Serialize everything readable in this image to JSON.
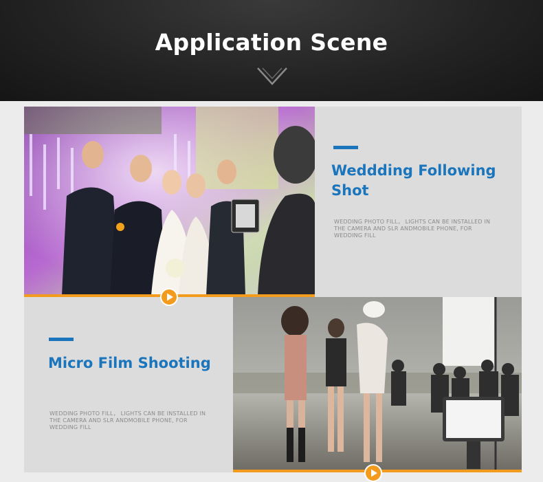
{
  "header": {
    "title": "Application Scene"
  },
  "section1": {
    "heading": "Weddding Following Shot",
    "description": "WEDDING PHOTO FILL， LIGHTS CAN BE INSTALLED IN THE CAMERA AND SLR ANDMOBILE PHONE, FOR WEDDING FILL"
  },
  "section2": {
    "heading": "Micro Film Shooting",
    "description": "WEDDING PHOTO FILL， LIGHTS CAN BE INSTALLED IN THE CAMERA AND SLR ANDMOBILE PHONE, FOR WEDDING FILL"
  },
  "colors": {
    "accent_blue": "#1b75bc",
    "accent_orange": "#f29b1d",
    "header_bg": "#1e1e1e"
  },
  "icons": [
    "chevron-down-icon",
    "play-icon"
  ]
}
